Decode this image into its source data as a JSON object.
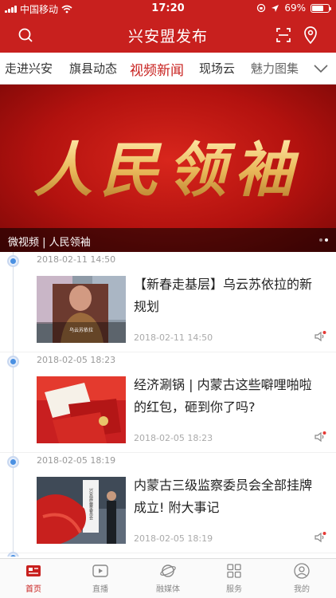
{
  "status_bar": {
    "carrier": "中国移动",
    "time": "17:20",
    "battery": "69%",
    "battery_level": 0.69
  },
  "header": {
    "title": "兴安盟发布"
  },
  "tabs": [
    {
      "label": "走进兴安"
    },
    {
      "label": "旗县动态"
    },
    {
      "label": "视频新闻",
      "active": true
    },
    {
      "label": "现场云"
    },
    {
      "label": "魅力图集"
    }
  ],
  "banner": {
    "art_text": "人民领袖",
    "caption": "微视频 | 人民领袖"
  },
  "news": [
    {
      "time": "2018-02-11 14:50",
      "title": "【新春走基层】乌云苏依拉的新规划",
      "date": "2018-02-11 14:50",
      "thumb_text": "乌云苏依拉"
    },
    {
      "time": "2018-02-05 18:23",
      "title": "经济涮锅 | 内蒙古这些噼哩啪啦的红包，砸到你了吗?",
      "date": "2018-02-05 18:23"
    },
    {
      "time": "2018-02-05 18:19",
      "title": "内蒙古三级监察委员会全部挂牌成立! 附大事记",
      "date": "2018-02-05 18:19",
      "thumb_text": "兴安盟监察委员会"
    }
  ],
  "bottom_nav": [
    {
      "label": "首页",
      "icon": "news-icon",
      "active": true
    },
    {
      "label": "直播",
      "icon": "play-icon"
    },
    {
      "label": "融媒体",
      "icon": "planet-icon"
    },
    {
      "label": "服务",
      "icon": "grid-icon"
    },
    {
      "label": "我的",
      "icon": "user-icon"
    }
  ],
  "colors": {
    "brand": "#c8201e",
    "timeline_dot": "#4a90e2"
  }
}
